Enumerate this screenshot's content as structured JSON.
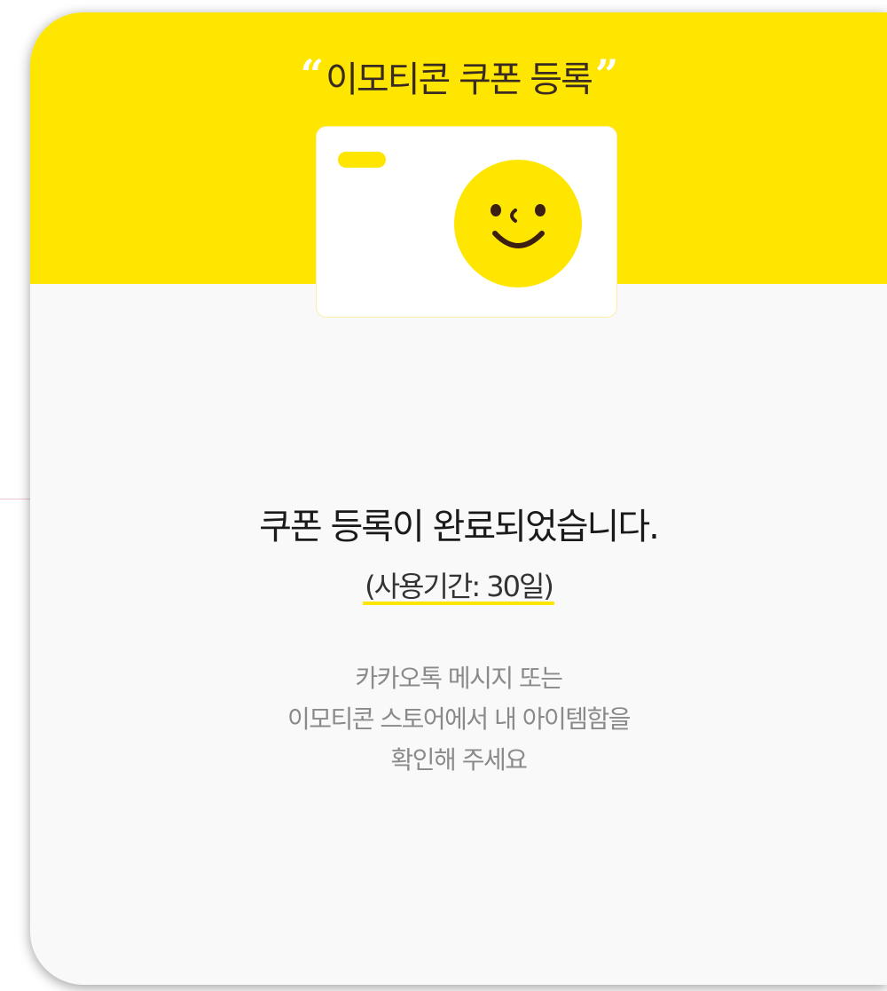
{
  "header": {
    "open_quote": "“",
    "title": "이모티콘 쿠폰 등록",
    "close_quote": "”"
  },
  "coupon": {
    "icon": "smiley-face-icon"
  },
  "message": {
    "main": "쿠폰 등록이 완료되었습니다.",
    "period": "(사용기간: 30일)"
  },
  "description": {
    "lines": [
      "카카오톡 메시지 또는",
      "이모티콘 스토어에서 내 아이템함을",
      "확인해 주세요"
    ]
  },
  "colors": {
    "accent_yellow": "#ffe600",
    "text_dark": "#1a1a1a",
    "text_muted": "#8a8a8a"
  }
}
